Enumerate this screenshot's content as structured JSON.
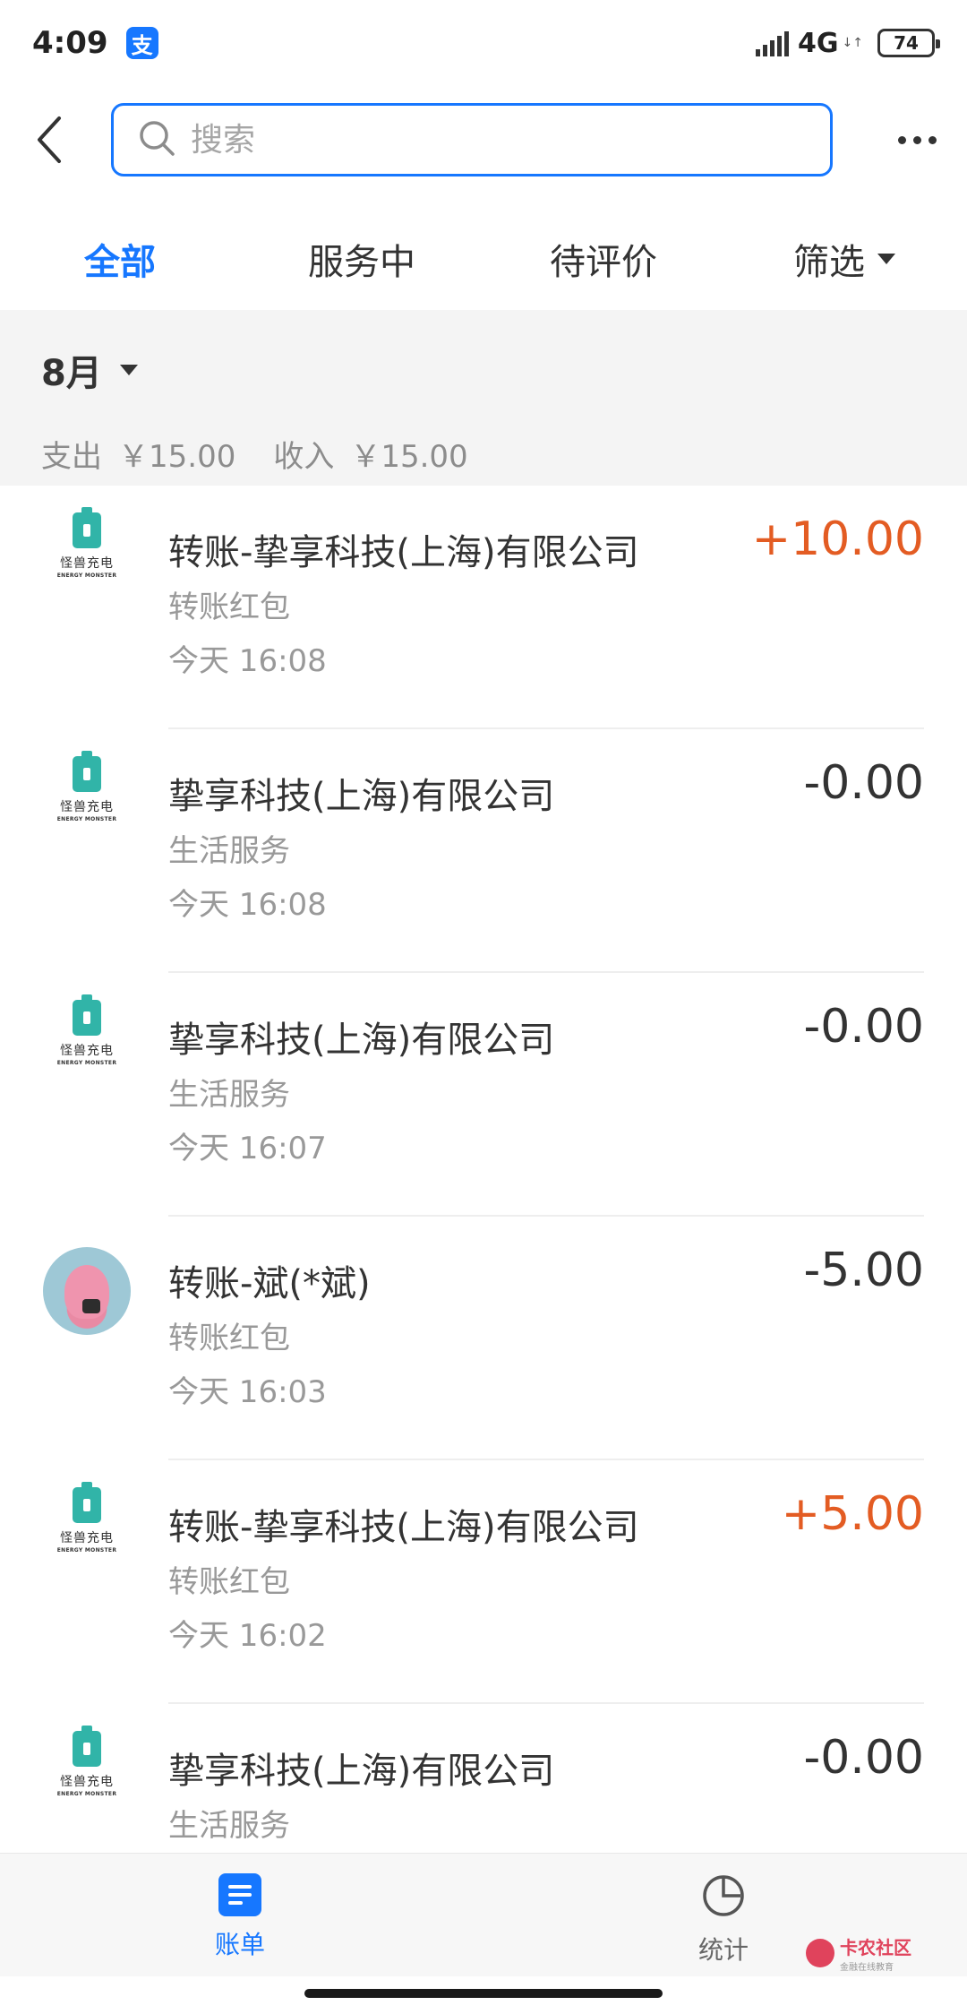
{
  "status_bar": {
    "time": "4:09",
    "app_badge": "支",
    "network": "4G",
    "battery": "74"
  },
  "header": {
    "search_placeholder": "搜索"
  },
  "tabs": [
    {
      "label": "全部",
      "active": true
    },
    {
      "label": "服务中",
      "active": false
    },
    {
      "label": "待评价",
      "active": false
    },
    {
      "label": "筛选",
      "active": false
    }
  ],
  "month": {
    "label": "8月",
    "expense_label": "支出",
    "expense_value": "￥15.00",
    "income_label": "收入",
    "income_value": "￥15.00"
  },
  "brand": {
    "name_cn": "怪兽充电",
    "name_en": "ENERGY MONSTER"
  },
  "transactions": [
    {
      "title": "转账-挚享科技(上海)有限公司",
      "category": "转账红包",
      "time": "今天  16:08",
      "amount": "+10.00",
      "type": "income",
      "avatar": "energy-monster"
    },
    {
      "title": "挚享科技(上海)有限公司",
      "category": "生活服务",
      "time": "今天  16:08",
      "amount": "-0.00",
      "type": "expense",
      "avatar": "energy-monster"
    },
    {
      "title": "挚享科技(上海)有限公司",
      "category": "生活服务",
      "time": "今天  16:07",
      "amount": "-0.00",
      "type": "expense",
      "avatar": "energy-monster"
    },
    {
      "title": "转账-斌(*斌)",
      "category": "转账红包",
      "time": "今天  16:03",
      "amount": "-5.00",
      "type": "expense",
      "avatar": "person"
    },
    {
      "title": "转账-挚享科技(上海)有限公司",
      "category": "转账红包",
      "time": "今天  16:02",
      "amount": "+5.00",
      "type": "income",
      "avatar": "energy-monster"
    },
    {
      "title": "挚享科技(上海)有限公司",
      "category": "生活服务",
      "time": "",
      "amount": "-0.00",
      "type": "expense",
      "avatar": "energy-monster"
    }
  ],
  "bottom_nav": {
    "bill_label": "账单",
    "stats_label": "统计"
  },
  "watermark": {
    "main": "卡农社区",
    "sub": "金融在线教育"
  },
  "colors": {
    "accent": "#1677ff",
    "income": "#e35c23",
    "brand_teal": "#31b4a8"
  }
}
